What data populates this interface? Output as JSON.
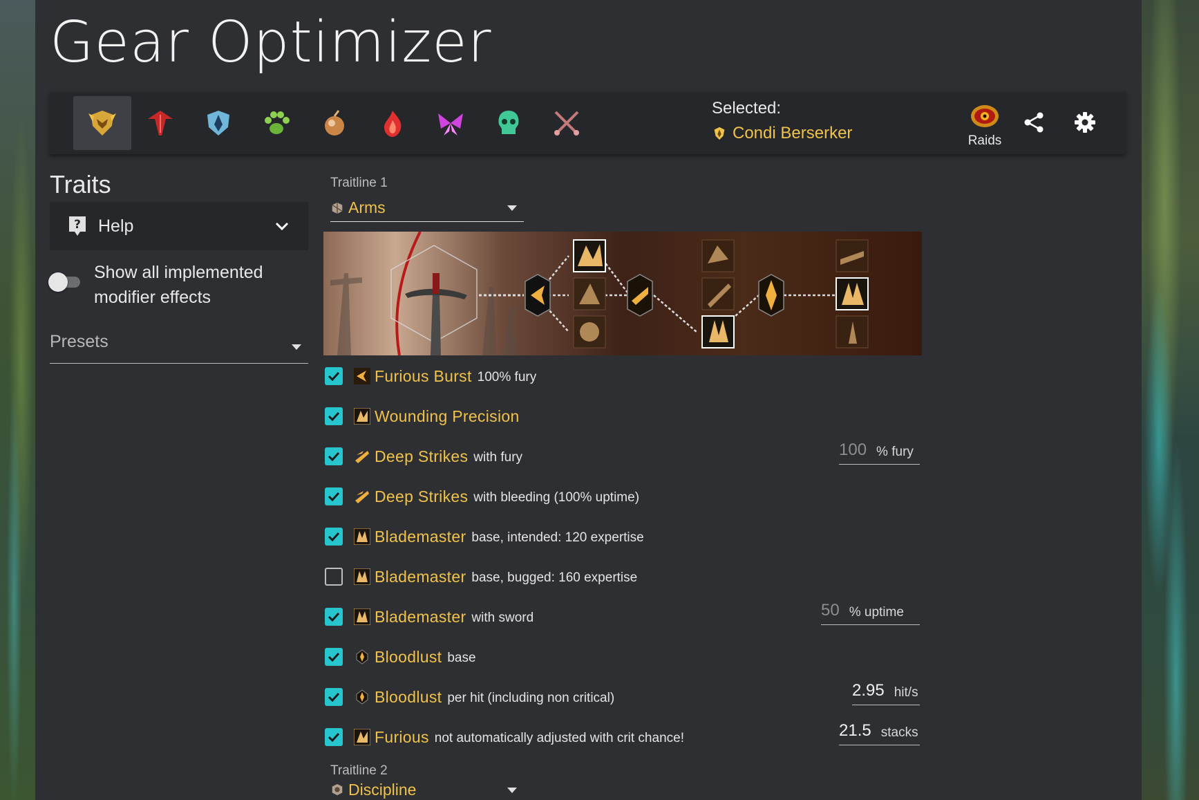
{
  "app": {
    "title": "Gear Optimizer"
  },
  "professions": [
    {
      "name": "guardian-icon",
      "color": "#f0c24a",
      "active": true
    },
    {
      "name": "revenant-icon",
      "color": "#d43030"
    },
    {
      "name": "warrior-icon",
      "color": "#8fd0e8"
    },
    {
      "name": "ranger-icon",
      "color": "#7cc24a"
    },
    {
      "name": "engineer-icon",
      "color": "#d79a55"
    },
    {
      "name": "elementalist-icon",
      "color": "#e84040"
    },
    {
      "name": "mesmer-icon",
      "color": "#d050e0"
    },
    {
      "name": "necromancer-icon",
      "color": "#52d0a0"
    },
    {
      "name": "thief-icon",
      "color": "#c88080"
    }
  ],
  "toolbar": {
    "selected_label": "Selected:",
    "selected_value": "Condi Berserker",
    "raids_label": "Raids"
  },
  "sidebar": {
    "heading": "Traits",
    "help_label": "Help",
    "toggle_label": "Show all implemented modifier effects",
    "presets_placeholder": "Presets"
  },
  "traitline1": {
    "label": "Traitline 1",
    "value": "Arms"
  },
  "traitline2": {
    "label": "Traitline 2",
    "value": "Discipline"
  },
  "modifiers": [
    {
      "name": "Furious Burst",
      "desc": "100% fury",
      "checked": true
    },
    {
      "name": "Wounding Precision",
      "desc": "",
      "checked": true
    },
    {
      "name": "Deep Strikes",
      "desc": "with fury",
      "checked": true
    },
    {
      "name": "Deep Strikes",
      "desc": "with bleeding (100% uptime)",
      "checked": true
    },
    {
      "name": "Blademaster",
      "desc": "base, intended: 120 expertise",
      "checked": true
    },
    {
      "name": "Blademaster",
      "desc": "base, bugged: 160 expertise",
      "checked": false
    },
    {
      "name": "Blademaster",
      "desc": "with sword",
      "checked": true
    },
    {
      "name": "Bloodlust",
      "desc": "base",
      "checked": true
    },
    {
      "name": "Bloodlust",
      "desc": "per hit (including non critical)",
      "checked": true
    },
    {
      "name": "Furious",
      "desc": "not automatically adjusted with crit chance!",
      "checked": true
    }
  ],
  "inputs": {
    "fury": {
      "value": "100",
      "unit": "% fury"
    },
    "uptime": {
      "value": "50",
      "unit": "% uptime"
    },
    "hits": {
      "value": "2.95",
      "unit": "hit/s"
    },
    "stacks": {
      "value": "21.5",
      "unit": "stacks"
    }
  },
  "colors": {
    "accent": "#27c6cf",
    "gold": "#f0c24a",
    "panel": "#2d2f33"
  }
}
